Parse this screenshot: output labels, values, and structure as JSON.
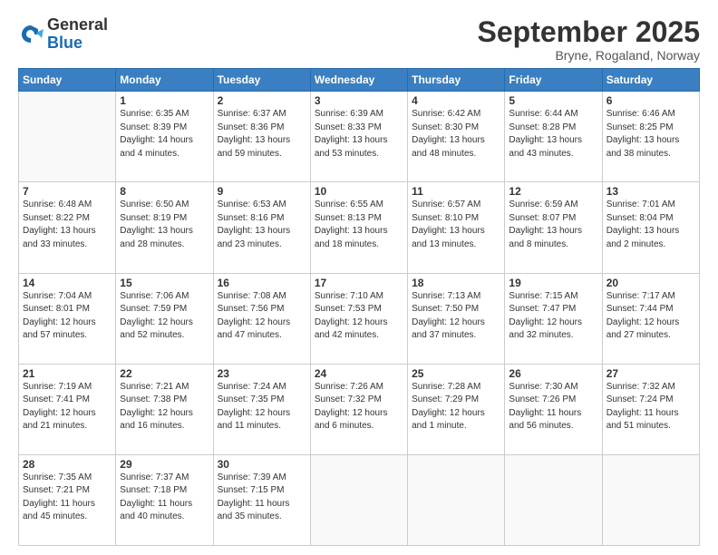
{
  "logo": {
    "general": "General",
    "blue": "Blue"
  },
  "title": "September 2025",
  "location": "Bryne, Rogaland, Norway",
  "weekdays": [
    "Sunday",
    "Monday",
    "Tuesday",
    "Wednesday",
    "Thursday",
    "Friday",
    "Saturday"
  ],
  "weeks": [
    [
      {
        "day": "",
        "info": ""
      },
      {
        "day": "1",
        "info": "Sunrise: 6:35 AM\nSunset: 8:39 PM\nDaylight: 14 hours\nand 4 minutes."
      },
      {
        "day": "2",
        "info": "Sunrise: 6:37 AM\nSunset: 8:36 PM\nDaylight: 13 hours\nand 59 minutes."
      },
      {
        "day": "3",
        "info": "Sunrise: 6:39 AM\nSunset: 8:33 PM\nDaylight: 13 hours\nand 53 minutes."
      },
      {
        "day": "4",
        "info": "Sunrise: 6:42 AM\nSunset: 8:30 PM\nDaylight: 13 hours\nand 48 minutes."
      },
      {
        "day": "5",
        "info": "Sunrise: 6:44 AM\nSunset: 8:28 PM\nDaylight: 13 hours\nand 43 minutes."
      },
      {
        "day": "6",
        "info": "Sunrise: 6:46 AM\nSunset: 8:25 PM\nDaylight: 13 hours\nand 38 minutes."
      }
    ],
    [
      {
        "day": "7",
        "info": "Sunrise: 6:48 AM\nSunset: 8:22 PM\nDaylight: 13 hours\nand 33 minutes."
      },
      {
        "day": "8",
        "info": "Sunrise: 6:50 AM\nSunset: 8:19 PM\nDaylight: 13 hours\nand 28 minutes."
      },
      {
        "day": "9",
        "info": "Sunrise: 6:53 AM\nSunset: 8:16 PM\nDaylight: 13 hours\nand 23 minutes."
      },
      {
        "day": "10",
        "info": "Sunrise: 6:55 AM\nSunset: 8:13 PM\nDaylight: 13 hours\nand 18 minutes."
      },
      {
        "day": "11",
        "info": "Sunrise: 6:57 AM\nSunset: 8:10 PM\nDaylight: 13 hours\nand 13 minutes."
      },
      {
        "day": "12",
        "info": "Sunrise: 6:59 AM\nSunset: 8:07 PM\nDaylight: 13 hours\nand 8 minutes."
      },
      {
        "day": "13",
        "info": "Sunrise: 7:01 AM\nSunset: 8:04 PM\nDaylight: 13 hours\nand 2 minutes."
      }
    ],
    [
      {
        "day": "14",
        "info": "Sunrise: 7:04 AM\nSunset: 8:01 PM\nDaylight: 12 hours\nand 57 minutes."
      },
      {
        "day": "15",
        "info": "Sunrise: 7:06 AM\nSunset: 7:59 PM\nDaylight: 12 hours\nand 52 minutes."
      },
      {
        "day": "16",
        "info": "Sunrise: 7:08 AM\nSunset: 7:56 PM\nDaylight: 12 hours\nand 47 minutes."
      },
      {
        "day": "17",
        "info": "Sunrise: 7:10 AM\nSunset: 7:53 PM\nDaylight: 12 hours\nand 42 minutes."
      },
      {
        "day": "18",
        "info": "Sunrise: 7:13 AM\nSunset: 7:50 PM\nDaylight: 12 hours\nand 37 minutes."
      },
      {
        "day": "19",
        "info": "Sunrise: 7:15 AM\nSunset: 7:47 PM\nDaylight: 12 hours\nand 32 minutes."
      },
      {
        "day": "20",
        "info": "Sunrise: 7:17 AM\nSunset: 7:44 PM\nDaylight: 12 hours\nand 27 minutes."
      }
    ],
    [
      {
        "day": "21",
        "info": "Sunrise: 7:19 AM\nSunset: 7:41 PM\nDaylight: 12 hours\nand 21 minutes."
      },
      {
        "day": "22",
        "info": "Sunrise: 7:21 AM\nSunset: 7:38 PM\nDaylight: 12 hours\nand 16 minutes."
      },
      {
        "day": "23",
        "info": "Sunrise: 7:24 AM\nSunset: 7:35 PM\nDaylight: 12 hours\nand 11 minutes."
      },
      {
        "day": "24",
        "info": "Sunrise: 7:26 AM\nSunset: 7:32 PM\nDaylight: 12 hours\nand 6 minutes."
      },
      {
        "day": "25",
        "info": "Sunrise: 7:28 AM\nSunset: 7:29 PM\nDaylight: 12 hours\nand 1 minute."
      },
      {
        "day": "26",
        "info": "Sunrise: 7:30 AM\nSunset: 7:26 PM\nDaylight: 11 hours\nand 56 minutes."
      },
      {
        "day": "27",
        "info": "Sunrise: 7:32 AM\nSunset: 7:24 PM\nDaylight: 11 hours\nand 51 minutes."
      }
    ],
    [
      {
        "day": "28",
        "info": "Sunrise: 7:35 AM\nSunset: 7:21 PM\nDaylight: 11 hours\nand 45 minutes."
      },
      {
        "day": "29",
        "info": "Sunrise: 7:37 AM\nSunset: 7:18 PM\nDaylight: 11 hours\nand 40 minutes."
      },
      {
        "day": "30",
        "info": "Sunrise: 7:39 AM\nSunset: 7:15 PM\nDaylight: 11 hours\nand 35 minutes."
      },
      {
        "day": "",
        "info": ""
      },
      {
        "day": "",
        "info": ""
      },
      {
        "day": "",
        "info": ""
      },
      {
        "day": "",
        "info": ""
      }
    ]
  ]
}
